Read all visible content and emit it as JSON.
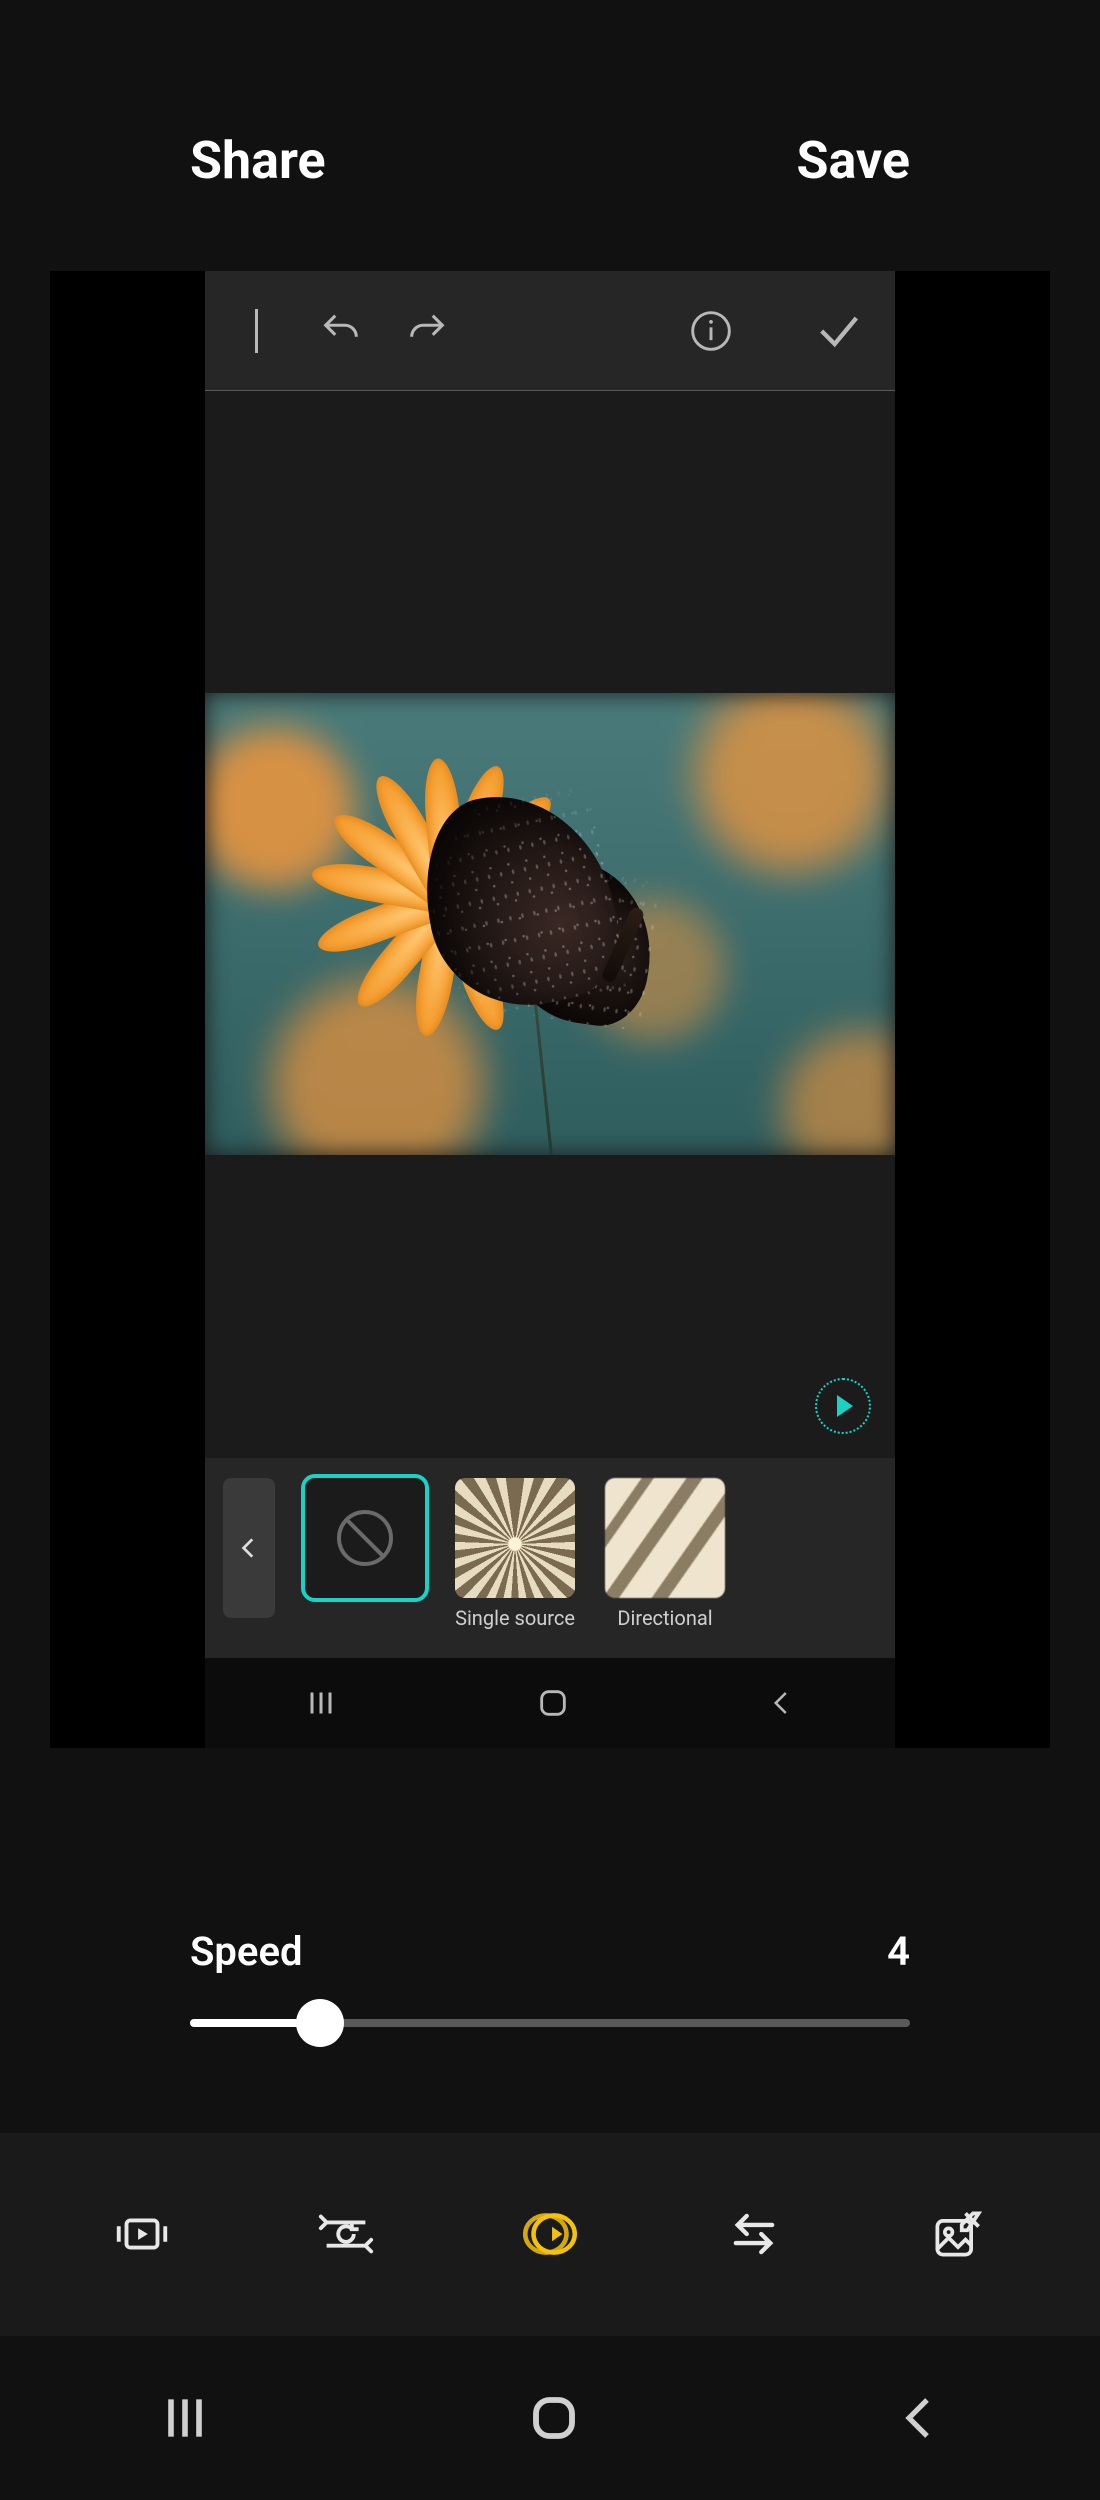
{
  "header": {
    "share_label": "Share",
    "save_label": "Save"
  },
  "effects": {
    "none_label": "",
    "single_source_label": "Single source",
    "directional_label": "Directional"
  },
  "speed": {
    "label": "Speed",
    "value": "4",
    "percent": 18
  },
  "colors": {
    "accent_teal": "#18d3c5",
    "accent_yellow": "#f4c20d"
  }
}
